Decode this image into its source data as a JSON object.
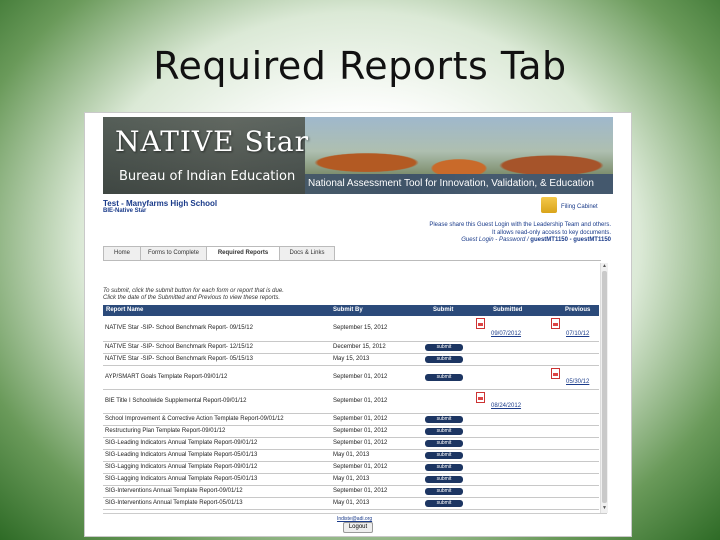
{
  "slide": {
    "title": "Required Reports Tab"
  },
  "banner": {
    "logo_text": "NATIVE Star",
    "org": "Bureau of Indian Education",
    "tagline": "National Assessment Tool for Innovation, Validation, & Education"
  },
  "school": {
    "title": "Test - Manyfarms High School",
    "subtitle": "BIE-Native Star"
  },
  "filing_cabinet": {
    "label": "Filing Cabinet",
    "icon": "folder-icon"
  },
  "guest": {
    "line1": "Please share this Guest Login with the Leadership Team and others.",
    "line2": "It allows read-only access to key documents.",
    "line3_prefix": "Guest Login - Password / ",
    "credentials": "guestMT1150 - guestMT1150"
  },
  "tabs": [
    "Home",
    "Forms to Complete",
    "Required Reports",
    "Docs & Links"
  ],
  "instructions": {
    "line1": "To submit, click the submit button for each form or report that is due.",
    "line2": "Click the date of the Submitted and Previous to view these reports."
  },
  "table": {
    "headers": [
      "Report Name",
      "Submit By",
      "Submit",
      "Submitted",
      "Previous"
    ],
    "submit_label": "submit",
    "rows": [
      {
        "name": "NATIVE Star -SIP- School Benchmark Report- 09/15/12",
        "by": "September 15, 2012",
        "submit": false,
        "submitted": "09/07/2012",
        "previous": "07/10/12"
      },
      {
        "name": "NATIVE Star -SIP- School Benchmark Report- 12/15/12",
        "by": "December 15, 2012",
        "submit": true,
        "submitted": "",
        "previous": ""
      },
      {
        "name": "NATIVE Star -SIP- School Benchmark Report- 05/15/13",
        "by": "May 15, 2013",
        "submit": true,
        "submitted": "",
        "previous": ""
      },
      {
        "name": "AYP/SMART Goals Template Report-09/01/12",
        "by": "September 01, 2012",
        "submit": true,
        "submitted": "",
        "previous": "05/30/12"
      },
      {
        "name": "BIE Title I Schoolwide Supplemental Report-09/01/12",
        "by": "September 01, 2012",
        "submit": false,
        "submitted": "08/24/2012",
        "previous": ""
      },
      {
        "name": "School Improvement & Corrective Action Template Report-09/01/12",
        "by": "September 01, 2012",
        "submit": true,
        "submitted": "",
        "previous": ""
      },
      {
        "name": "Restructuring Plan Template Report-09/01/12",
        "by": "September 01, 2012",
        "submit": true,
        "submitted": "",
        "previous": ""
      },
      {
        "name": "SIG-Leading Indicators Annual Template Report-09/01/12",
        "by": "September 01, 2012",
        "submit": true,
        "submitted": "",
        "previous": ""
      },
      {
        "name": "SIG-Leading Indicators Annual Template Report-05/01/13",
        "by": "May 01, 2013",
        "submit": true,
        "submitted": "",
        "previous": ""
      },
      {
        "name": "SIG-Lagging Indicators Annual Template Report-09/01/12",
        "by": "September 01, 2012",
        "submit": true,
        "submitted": "",
        "previous": ""
      },
      {
        "name": "SIG-Lagging Indicators Annual Template Report-05/01/13",
        "by": "May 01, 2013",
        "submit": true,
        "submitted": "",
        "previous": ""
      },
      {
        "name": "SIG-Interventions Annual Template Report-09/01/12",
        "by": "September 01, 2012",
        "submit": true,
        "submitted": "",
        "previous": ""
      },
      {
        "name": "SIG-Interventions Annual Template Report-05/01/13",
        "by": "May 01, 2013",
        "submit": true,
        "submitted": "",
        "previous": ""
      }
    ]
  },
  "footer": {
    "email": "Indiste@adi.org",
    "logout": "Logout"
  }
}
